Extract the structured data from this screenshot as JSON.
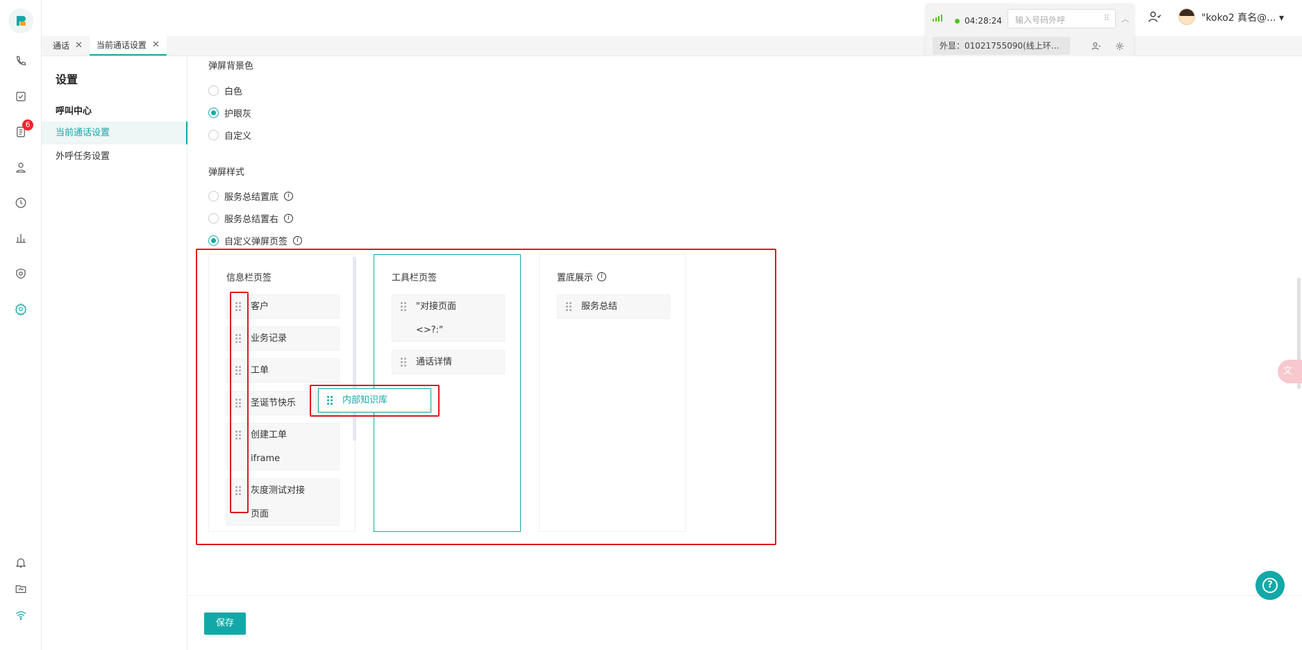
{
  "rail": {
    "badge_count": "6"
  },
  "tabs": [
    {
      "label": "通话"
    },
    {
      "label": "当前通话设置"
    }
  ],
  "call_widget": {
    "timer": "04:28:24",
    "dial_placeholder": "输入号码外呼",
    "outline": "外显：01021755090(线上环..."
  },
  "user": {
    "name": "\"koko2 真名@..."
  },
  "nav": {
    "title": "设置",
    "section": "呼叫中心",
    "items": [
      {
        "label": "当前通话设置"
      },
      {
        "label": "外呼任务设置"
      }
    ]
  },
  "main": {
    "bg_title": "弹屏背景色",
    "bg_options": [
      "白色",
      "护眼灰",
      "自定义"
    ],
    "bg_selected": "护眼灰",
    "style_title": "弹屏样式",
    "style_options": [
      "服务总结置底",
      "服务总结置右",
      "自定义弹屏页签"
    ],
    "style_selected": "自定义弹屏页签",
    "columns": [
      {
        "title": "信息栏页签",
        "cards": [
          "客户",
          "业务记录",
          "工单",
          "圣诞节快乐",
          "创建工单\niframe",
          "灰度测试对接\n页面"
        ]
      },
      {
        "title": "工具栏页签",
        "cards": [
          "\"对接页面\n<>?:\"",
          "通话详情"
        ]
      },
      {
        "title": "置底展示",
        "cards": [
          "服务总结"
        ]
      }
    ],
    "dragging_card": "内部知识库"
  },
  "footer": {
    "save_label": "保存"
  },
  "colors": {
    "accent": "#13a8a8",
    "annotation": "#e01818",
    "badge": "#f5222d"
  }
}
